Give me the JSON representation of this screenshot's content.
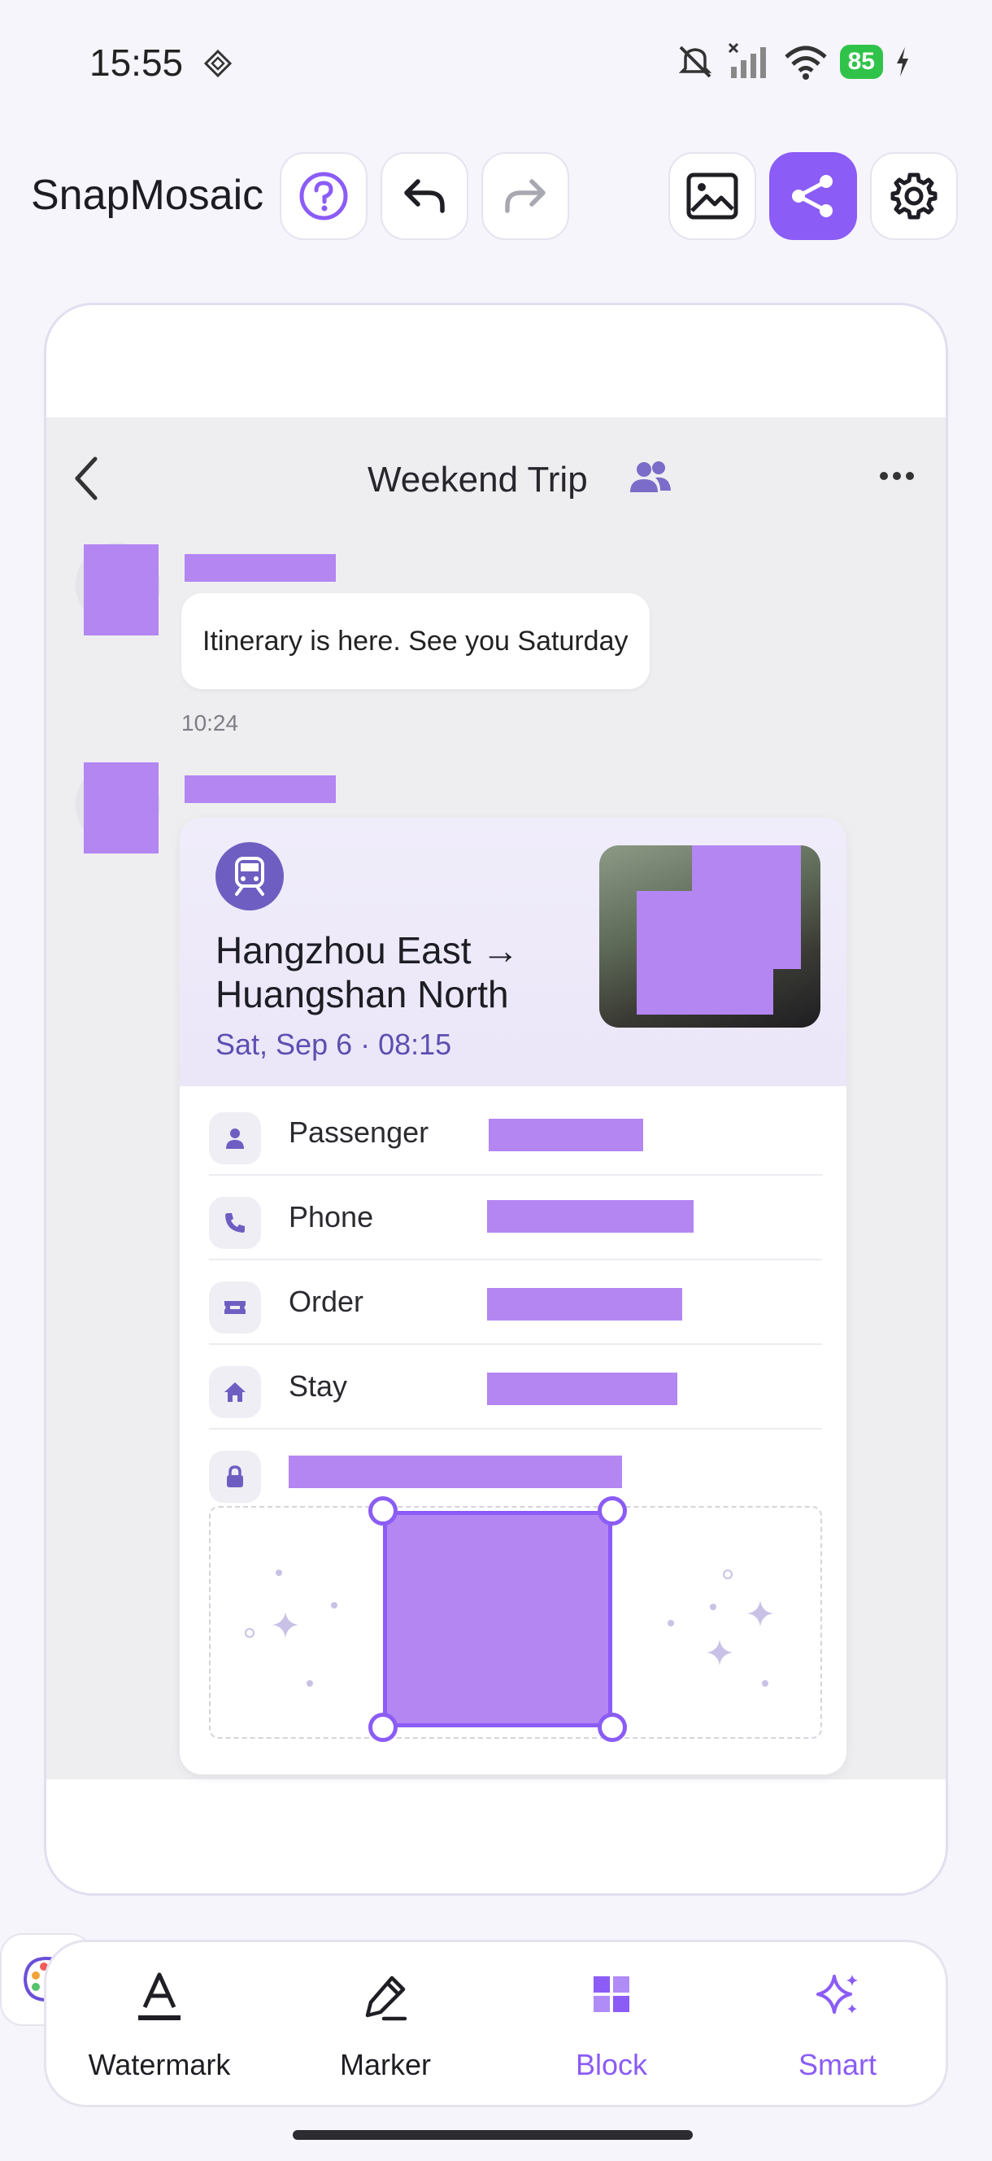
{
  "status_bar": {
    "time": "15:55",
    "battery": "85"
  },
  "toolbar": {
    "app_title": "SnapMosaic"
  },
  "chat": {
    "title": "Weekend Trip",
    "message": "Itinerary is here. See you Saturday",
    "timestamp": "10:24"
  },
  "ticket": {
    "route": "Hangzhou East → Huangshan North",
    "date": "Sat, Sep 6 · 08:15",
    "rows": [
      {
        "label": "Passenger",
        "icon": "person-icon"
      },
      {
        "label": "Phone",
        "icon": "phone-icon"
      },
      {
        "label": "Order",
        "icon": "ticket-icon"
      },
      {
        "label": "Stay",
        "icon": "home-icon"
      },
      {
        "label": "",
        "icon": "lock-icon"
      }
    ]
  },
  "tools": [
    {
      "label": "Watermark",
      "icon": "text-underline-icon",
      "active": false
    },
    {
      "label": "Marker",
      "icon": "pen-icon",
      "active": false
    },
    {
      "label": "Block",
      "icon": "grid-block-icon",
      "active": true
    },
    {
      "label": "Smart",
      "icon": "sparkle-icon",
      "active": true
    }
  ],
  "colors": {
    "accent": "#8b5cf6",
    "mosaic": "#b386f2",
    "battery": "#30c34a"
  }
}
